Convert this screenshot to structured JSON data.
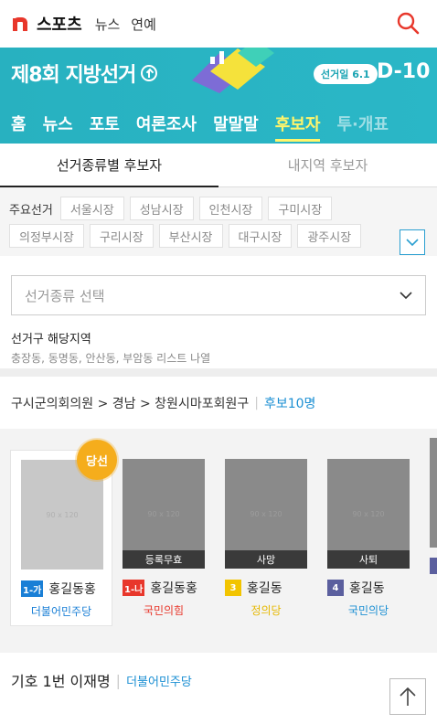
{
  "header": {
    "brand": "스포츠",
    "links": [
      "뉴스",
      "연예"
    ]
  },
  "banner": {
    "title": "제8회 지방선거",
    "election_date": "선거일 6.1",
    "dday": "D-10",
    "tabs": [
      "홈",
      "뉴스",
      "포토",
      "여론조사",
      "말말말",
      "후보자",
      "투·개표"
    ],
    "active_tab": "후보자",
    "colors": {
      "background": "#2ab7c7",
      "active": "#fff56b"
    }
  },
  "sub_tabs": [
    {
      "label": "선거종류별 후보자",
      "active": true
    },
    {
      "label": "내지역 후보자",
      "active": false
    }
  ],
  "cities": {
    "label": "주요선거",
    "row1": [
      "서울시장",
      "성남시장",
      "인천시장",
      "구미시장"
    ],
    "row2": [
      "의정부시장",
      "구리시장",
      "부산시장",
      "대구시장",
      "광주시장"
    ]
  },
  "select": {
    "placeholder": "선거종류 선택"
  },
  "info": {
    "label": "선거구 해당지역",
    "desc": "충장동, 동명동, 안산동, 부암동 리스트 나열"
  },
  "path": {
    "text": "구시군의회의원 > 경남 > 창원시마포회원구",
    "count": "후보10명"
  },
  "candidates": [
    {
      "number": "1-가",
      "name": "홍길동홍",
      "party": "더불어민주당",
      "status": "",
      "winner": true,
      "winner_label": "당선",
      "placeholder": "90 x 120",
      "num_color": "#1a7fd6",
      "party_color": "#1a7fd6"
    },
    {
      "number": "1-나",
      "name": "홍길동홍",
      "party": "국민의힘",
      "status": "등록무효",
      "winner": false,
      "winner_label": "",
      "placeholder": "90 x 120",
      "num_color": "#e8372b",
      "party_color": "#e8372b"
    },
    {
      "number": "3",
      "name": "홍길동",
      "party": "정의당",
      "status": "사망",
      "winner": false,
      "winner_label": "",
      "placeholder": "90 x 120",
      "num_color": "#f2c400",
      "party_color": "#e6b800"
    },
    {
      "number": "4",
      "name": "홍길동",
      "party": "국민의당",
      "status": "사퇴",
      "winner": false,
      "winner_label": "",
      "placeholder": "90 x 120",
      "num_color": "#5b5f9e",
      "party_color": "#1b8fd3"
    }
  ],
  "bottom": {
    "title": "기호 1번 이재명",
    "party": "더불어민주당"
  },
  "icons": {
    "search": "search-icon",
    "chevron": "chevron-down-icon",
    "arrow_up": "arrow-up-icon"
  }
}
